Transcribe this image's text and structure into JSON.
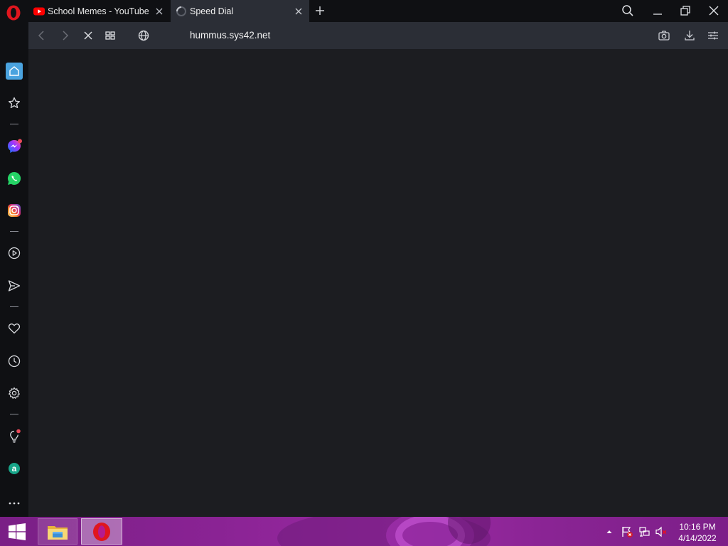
{
  "tabs": [
    {
      "label": "School Memes - YouTube",
      "favicon": "youtube-icon",
      "active": false
    },
    {
      "label": "Speed Dial",
      "favicon": "loading-spinner-icon",
      "active": true
    }
  ],
  "address_bar": {
    "url": "hummus.sys42.net",
    "site_icon": "globe-icon"
  },
  "sidebar": {
    "items": [
      {
        "name": "home",
        "icon": "home-icon",
        "active": true
      },
      {
        "name": "bookmarks",
        "icon": "star-icon"
      },
      {
        "name": "messenger",
        "icon": "messenger-icon",
        "notification": true
      },
      {
        "name": "whatsapp",
        "icon": "whatsapp-icon"
      },
      {
        "name": "instagram",
        "icon": "instagram-icon"
      },
      {
        "name": "player",
        "icon": "play-circle-icon"
      },
      {
        "name": "flow",
        "icon": "send-icon"
      },
      {
        "name": "pinboards",
        "icon": "heart-icon"
      },
      {
        "name": "history",
        "icon": "clock-icon"
      },
      {
        "name": "settings",
        "icon": "gear-icon"
      },
      {
        "name": "tips",
        "icon": "lightbulb-icon",
        "notification": true
      },
      {
        "name": "aria",
        "icon": "aria-icon"
      },
      {
        "name": "more",
        "icon": "more-dots-icon"
      }
    ]
  },
  "taskbar": {
    "pinned": [
      {
        "name": "file-explorer",
        "icon": "folder-icon"
      },
      {
        "name": "opera",
        "icon": "opera-icon",
        "active": true
      }
    ],
    "tray_icons": [
      "chevron-up-icon",
      "action-center-flag-icon",
      "network-icon",
      "volume-muted-icon"
    ],
    "clock": {
      "time": "10:16 PM",
      "date": "4/14/2022"
    }
  },
  "colors": {
    "titlebar": "#0f1013",
    "toolbar": "#2b2e36",
    "content": "#1c1d21",
    "accent": "#4aa3df",
    "opera_red": "#e0161e",
    "taskbar": "#8a2394"
  }
}
